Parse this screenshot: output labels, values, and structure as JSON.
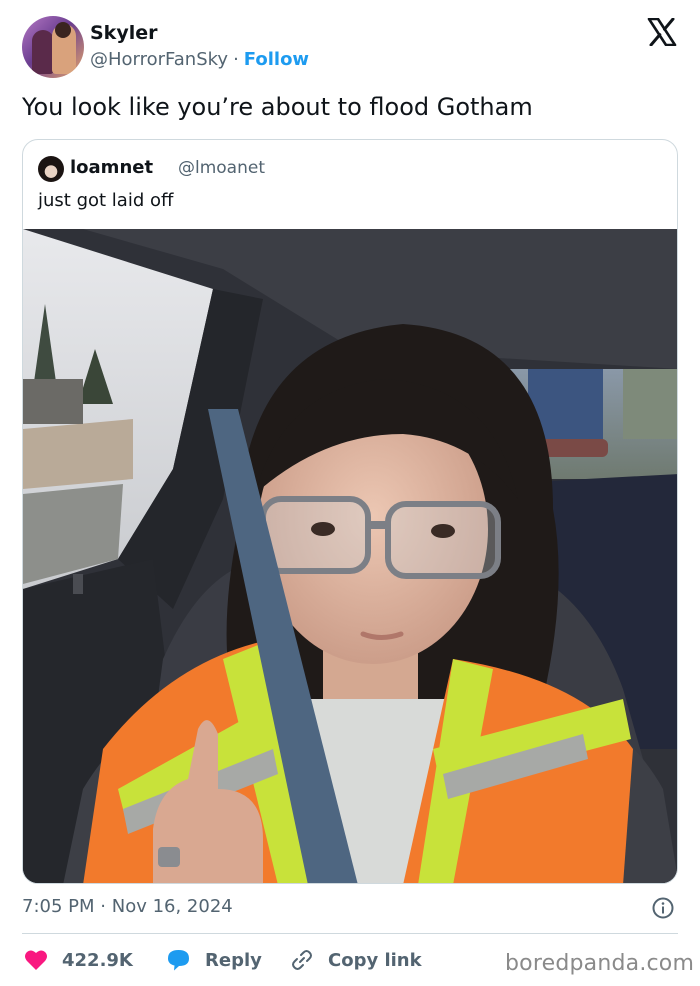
{
  "author": {
    "display_name": "Skyler",
    "handle": "@HorrorFanSky",
    "separator": "·",
    "follow_label": "Follow"
  },
  "tweet": {
    "text": "You look like you’re about to flood Gotham",
    "time": "7:05 PM",
    "separator": "·",
    "date": "Nov 16, 2024"
  },
  "quoted": {
    "display_name": "loamnet",
    "handle": "@lmoanet",
    "text": "just got laid off"
  },
  "actions": {
    "likes_count": "422.9K",
    "reply_label": "Reply",
    "copy_link_label": "Copy link"
  },
  "watermark": "boredpanda.com",
  "colors": {
    "accent": "#1d9bf0",
    "like": "#f91880",
    "text_primary": "#0f1419",
    "text_secondary": "#536471",
    "border": "#cfd9de"
  },
  "icons": {
    "brand": "x-logo-icon",
    "info": "info-icon",
    "like": "heart-icon",
    "reply": "speech-bubble-icon",
    "copy": "link-icon"
  }
}
